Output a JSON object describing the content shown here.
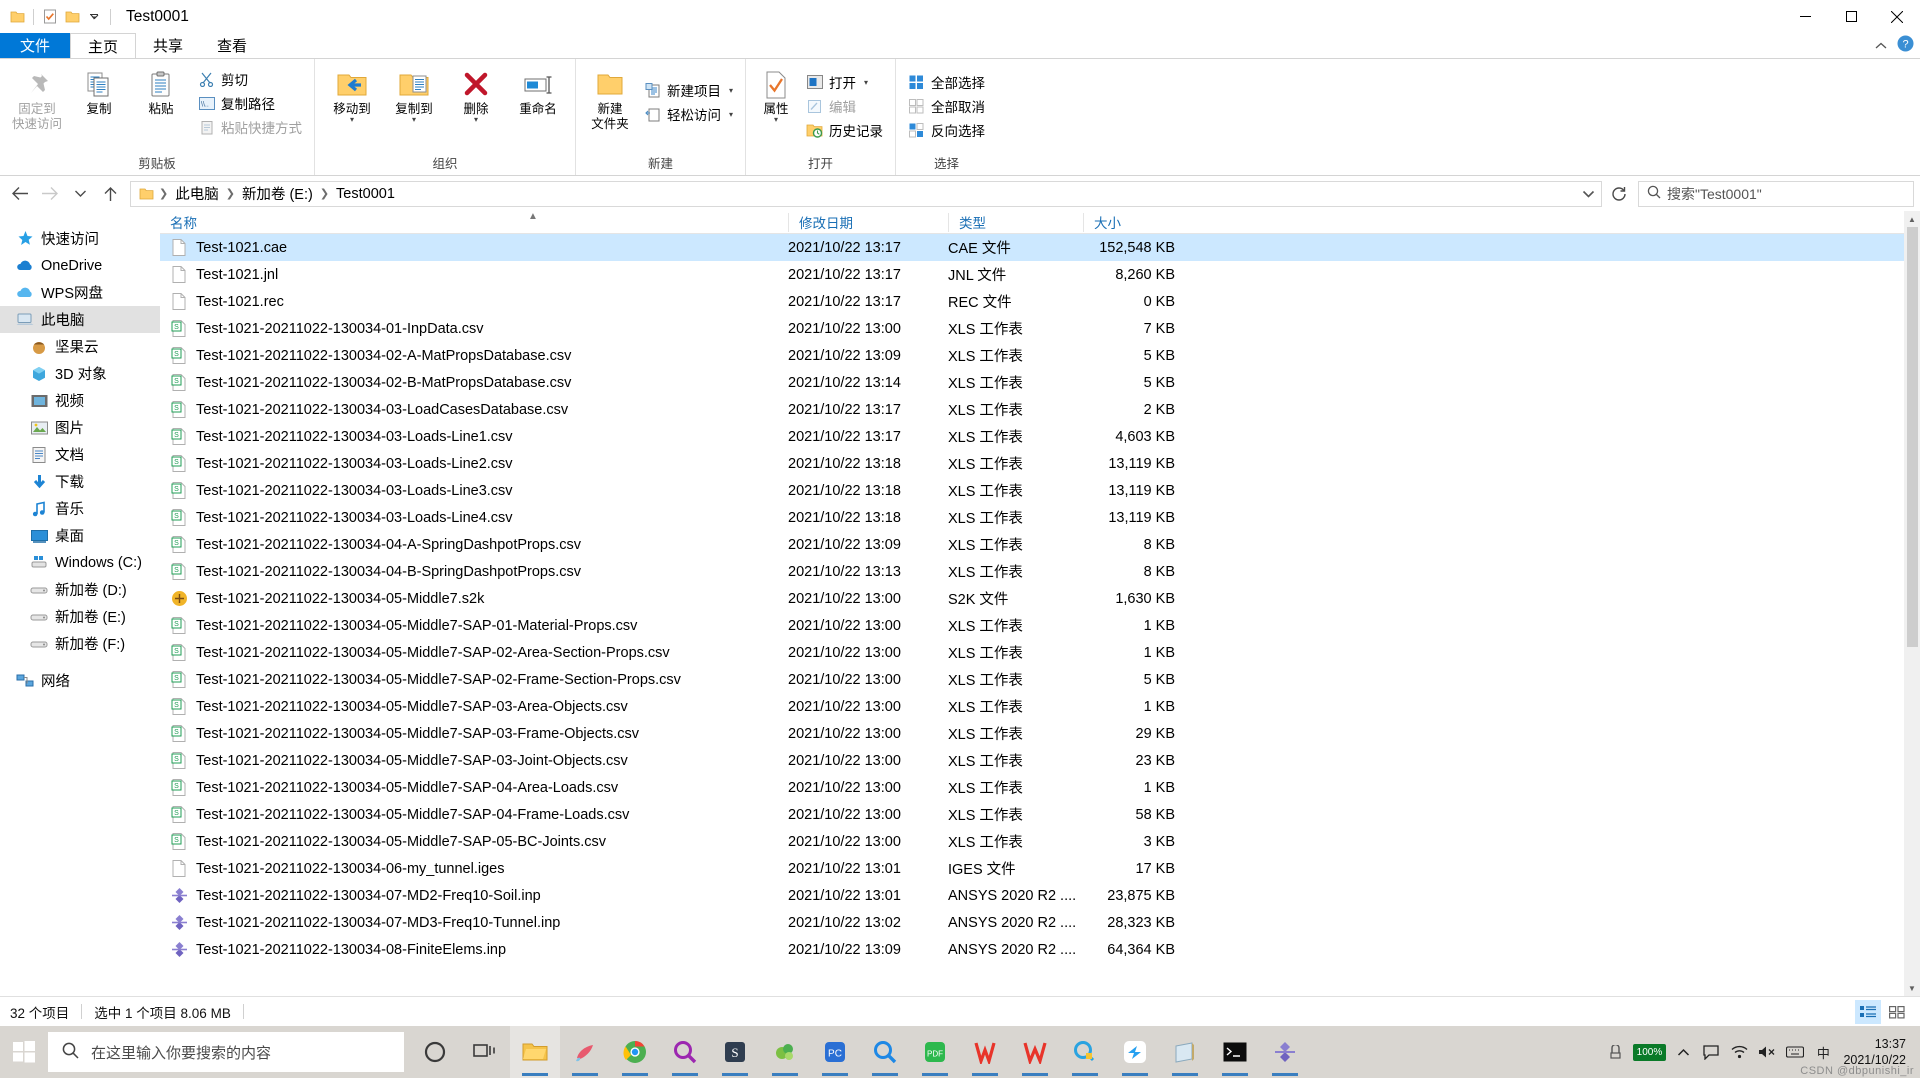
{
  "window": {
    "title": "Test0001",
    "qat": [
      "folder-icon",
      "properties-icon",
      "new-folder-icon",
      "customize-dropdown-icon"
    ],
    "buttons": {
      "minimize": "minimize-icon",
      "maximize": "maximize-icon",
      "close": "close-icon"
    }
  },
  "ribbon": {
    "tabs": [
      {
        "label": "文件",
        "kind": "file"
      },
      {
        "label": "主页",
        "kind": "active"
      },
      {
        "label": "共享",
        "kind": "normal"
      },
      {
        "label": "查看",
        "kind": "normal"
      }
    ],
    "groups": [
      {
        "label": "剪贴板",
        "big": [
          {
            "label": "固定到\n快速访问",
            "icon": "pin-icon",
            "disabled": true
          },
          {
            "label": "复制",
            "icon": "copy-icon",
            "disabled": false
          },
          {
            "label": "粘贴",
            "icon": "paste-icon",
            "disabled": false
          }
        ],
        "small": [
          {
            "label": "剪切",
            "icon": "scissors-icon",
            "disabled": false
          },
          {
            "label": "复制路径",
            "icon": "copy-path-icon",
            "disabled": false
          },
          {
            "label": "粘贴快捷方式",
            "icon": "paste-shortcut-icon",
            "disabled": true
          }
        ]
      },
      {
        "label": "组织",
        "big": [
          {
            "label": "移动到",
            "icon": "move-to-icon",
            "dropdown": true
          },
          {
            "label": "复制到",
            "icon": "copy-to-icon",
            "dropdown": true
          },
          {
            "label": "删除",
            "icon": "delete-icon",
            "dropdown": true
          },
          {
            "label": "重命名",
            "icon": "rename-icon",
            "dropdown": false
          }
        ],
        "small": []
      },
      {
        "label": "新建",
        "big": [
          {
            "label": "新建\n文件夹",
            "icon": "new-folder-icon",
            "dropdown": false
          }
        ],
        "small": [
          {
            "label": "新建项目",
            "icon": "new-item-icon",
            "dropdown": true
          },
          {
            "label": "轻松访问",
            "icon": "easy-access-icon",
            "dropdown": true
          }
        ]
      },
      {
        "label": "打开",
        "big": [
          {
            "label": "属性",
            "icon": "properties-icon",
            "dropdown": true
          }
        ],
        "small": [
          {
            "label": "打开",
            "icon": "open-icon",
            "dropdown": true
          },
          {
            "label": "编辑",
            "icon": "edit-icon",
            "disabled": true
          },
          {
            "label": "历史记录",
            "icon": "history-icon",
            "disabled": false
          }
        ]
      },
      {
        "label": "选择",
        "big": [],
        "small": [
          {
            "label": "全部选择",
            "icon": "select-all-icon"
          },
          {
            "label": "全部取消",
            "icon": "select-none-icon"
          },
          {
            "label": "反向选择",
            "icon": "invert-selection-icon"
          }
        ]
      }
    ]
  },
  "address": {
    "back": "back-arrow-icon",
    "forward": "forward-arrow-icon",
    "recent": "recent-locations-icon",
    "up": "up-arrow-icon",
    "crumbs": [
      "此电脑",
      "新加卷 (E:)",
      "Test0001"
    ],
    "refresh": "refresh-icon",
    "search_placeholder": "搜索\"Test0001\"",
    "search_value": ""
  },
  "sidebar": {
    "items": [
      {
        "label": "快速访问",
        "icon": "quick-access-star-icon",
        "level": 1,
        "selected": false
      },
      {
        "label": "OneDrive",
        "icon": "onedrive-cloud-icon",
        "level": 1,
        "selected": false
      },
      {
        "label": "WPS网盘",
        "icon": "wps-cloud-icon",
        "level": 1,
        "selected": false
      },
      {
        "label": "此电脑",
        "icon": "this-pc-icon",
        "level": 1,
        "selected": true
      },
      {
        "label": "坚果云",
        "icon": "nutstore-icon",
        "level": 2,
        "selected": false
      },
      {
        "label": "3D 对象",
        "icon": "3d-objects-icon",
        "level": 2,
        "selected": false
      },
      {
        "label": "视频",
        "icon": "videos-icon",
        "level": 2,
        "selected": false
      },
      {
        "label": "图片",
        "icon": "pictures-icon",
        "level": 2,
        "selected": false
      },
      {
        "label": "文档",
        "icon": "documents-icon",
        "level": 2,
        "selected": false
      },
      {
        "label": "下载",
        "icon": "downloads-icon",
        "level": 2,
        "selected": false
      },
      {
        "label": "音乐",
        "icon": "music-icon",
        "level": 2,
        "selected": false
      },
      {
        "label": "桌面",
        "icon": "desktop-icon",
        "level": 2,
        "selected": false
      },
      {
        "label": "Windows (C:)",
        "icon": "windows-drive-icon",
        "level": 2,
        "selected": false
      },
      {
        "label": "新加卷 (D:)",
        "icon": "drive-icon",
        "level": 2,
        "selected": false
      },
      {
        "label": "新加卷 (E:)",
        "icon": "drive-icon",
        "level": 2,
        "selected": false
      },
      {
        "label": "新加卷 (F:)",
        "icon": "drive-icon",
        "level": 2,
        "selected": false
      },
      {
        "label": "网络",
        "icon": "network-icon",
        "level": 1,
        "selected": false
      }
    ]
  },
  "filelist": {
    "columns": [
      "名称",
      "修改日期",
      "类型",
      "大小"
    ],
    "sort_column": "名称",
    "sort_dir": "asc",
    "rows": [
      {
        "name": "Test-1021.cae",
        "date": "2021/10/22 13:17",
        "type": "CAE 文件",
        "size": "152,548 KB",
        "icon": "generic-file-icon",
        "selected": true
      },
      {
        "name": "Test-1021.jnl",
        "date": "2021/10/22 13:17",
        "type": "JNL 文件",
        "size": "8,260 KB",
        "icon": "generic-file-icon",
        "selected": false
      },
      {
        "name": "Test-1021.rec",
        "date": "2021/10/22 13:17",
        "type": "REC 文件",
        "size": "0 KB",
        "icon": "generic-file-icon",
        "selected": false
      },
      {
        "name": "Test-1021-20211022-130034-01-InpData.csv",
        "date": "2021/10/22 13:00",
        "type": "XLS 工作表",
        "size": "7 KB",
        "icon": "csv-file-icon",
        "selected": false
      },
      {
        "name": "Test-1021-20211022-130034-02-A-MatPropsDatabase.csv",
        "date": "2021/10/22 13:09",
        "type": "XLS 工作表",
        "size": "5 KB",
        "icon": "csv-file-icon",
        "selected": false
      },
      {
        "name": "Test-1021-20211022-130034-02-B-MatPropsDatabase.csv",
        "date": "2021/10/22 13:14",
        "type": "XLS 工作表",
        "size": "5 KB",
        "icon": "csv-file-icon",
        "selected": false
      },
      {
        "name": "Test-1021-20211022-130034-03-LoadCasesDatabase.csv",
        "date": "2021/10/22 13:17",
        "type": "XLS 工作表",
        "size": "2 KB",
        "icon": "csv-file-icon",
        "selected": false
      },
      {
        "name": "Test-1021-20211022-130034-03-Loads-Line1.csv",
        "date": "2021/10/22 13:17",
        "type": "XLS 工作表",
        "size": "4,603 KB",
        "icon": "csv-file-icon",
        "selected": false
      },
      {
        "name": "Test-1021-20211022-130034-03-Loads-Line2.csv",
        "date": "2021/10/22 13:18",
        "type": "XLS 工作表",
        "size": "13,119 KB",
        "icon": "csv-file-icon",
        "selected": false
      },
      {
        "name": "Test-1021-20211022-130034-03-Loads-Line3.csv",
        "date": "2021/10/22 13:18",
        "type": "XLS 工作表",
        "size": "13,119 KB",
        "icon": "csv-file-icon",
        "selected": false
      },
      {
        "name": "Test-1021-20211022-130034-03-Loads-Line4.csv",
        "date": "2021/10/22 13:18",
        "type": "XLS 工作表",
        "size": "13,119 KB",
        "icon": "csv-file-icon",
        "selected": false
      },
      {
        "name": "Test-1021-20211022-130034-04-A-SpringDashpotProps.csv",
        "date": "2021/10/22 13:09",
        "type": "XLS 工作表",
        "size": "8 KB",
        "icon": "csv-file-icon",
        "selected": false
      },
      {
        "name": "Test-1021-20211022-130034-04-B-SpringDashpotProps.csv",
        "date": "2021/10/22 13:13",
        "type": "XLS 工作表",
        "size": "8 KB",
        "icon": "csv-file-icon",
        "selected": false
      },
      {
        "name": "Test-1021-20211022-130034-05-Middle7.s2k",
        "date": "2021/10/22 13:00",
        "type": "S2K 文件",
        "size": "1,630 KB",
        "icon": "s2k-file-icon",
        "selected": false
      },
      {
        "name": "Test-1021-20211022-130034-05-Middle7-SAP-01-Material-Props.csv",
        "date": "2021/10/22 13:00",
        "type": "XLS 工作表",
        "size": "1 KB",
        "icon": "csv-file-icon",
        "selected": false
      },
      {
        "name": "Test-1021-20211022-130034-05-Middle7-SAP-02-Area-Section-Props.csv",
        "date": "2021/10/22 13:00",
        "type": "XLS 工作表",
        "size": "1 KB",
        "icon": "csv-file-icon",
        "selected": false
      },
      {
        "name": "Test-1021-20211022-130034-05-Middle7-SAP-02-Frame-Section-Props.csv",
        "date": "2021/10/22 13:00",
        "type": "XLS 工作表",
        "size": "5 KB",
        "icon": "csv-file-icon",
        "selected": false
      },
      {
        "name": "Test-1021-20211022-130034-05-Middle7-SAP-03-Area-Objects.csv",
        "date": "2021/10/22 13:00",
        "type": "XLS 工作表",
        "size": "1 KB",
        "icon": "csv-file-icon",
        "selected": false
      },
      {
        "name": "Test-1021-20211022-130034-05-Middle7-SAP-03-Frame-Objects.csv",
        "date": "2021/10/22 13:00",
        "type": "XLS 工作表",
        "size": "29 KB",
        "icon": "csv-file-icon",
        "selected": false
      },
      {
        "name": "Test-1021-20211022-130034-05-Middle7-SAP-03-Joint-Objects.csv",
        "date": "2021/10/22 13:00",
        "type": "XLS 工作表",
        "size": "23 KB",
        "icon": "csv-file-icon",
        "selected": false
      },
      {
        "name": "Test-1021-20211022-130034-05-Middle7-SAP-04-Area-Loads.csv",
        "date": "2021/10/22 13:00",
        "type": "XLS 工作表",
        "size": "1 KB",
        "icon": "csv-file-icon",
        "selected": false
      },
      {
        "name": "Test-1021-20211022-130034-05-Middle7-SAP-04-Frame-Loads.csv",
        "date": "2021/10/22 13:00",
        "type": "XLS 工作表",
        "size": "58 KB",
        "icon": "csv-file-icon",
        "selected": false
      },
      {
        "name": "Test-1021-20211022-130034-05-Middle7-SAP-05-BC-Joints.csv",
        "date": "2021/10/22 13:00",
        "type": "XLS 工作表",
        "size": "3 KB",
        "icon": "csv-file-icon",
        "selected": false
      },
      {
        "name": "Test-1021-20211022-130034-06-my_tunnel.iges",
        "date": "2021/10/22 13:01",
        "type": "IGES 文件",
        "size": "17 KB",
        "icon": "generic-file-icon",
        "selected": false
      },
      {
        "name": "Test-1021-20211022-130034-07-MD2-Freq10-Soil.inp",
        "date": "2021/10/22 13:01",
        "type": "ANSYS 2020 R2 ....",
        "size": "23,875 KB",
        "icon": "ansys-file-icon",
        "selected": false
      },
      {
        "name": "Test-1021-20211022-130034-07-MD3-Freq10-Tunnel.inp",
        "date": "2021/10/22 13:02",
        "type": "ANSYS 2020 R2 ....",
        "size": "28,323 KB",
        "icon": "ansys-file-icon",
        "selected": false
      },
      {
        "name": "Test-1021-20211022-130034-08-FiniteElems.inp",
        "date": "2021/10/22 13:09",
        "type": "ANSYS 2020 R2 ....",
        "size": "64,364 KB",
        "icon": "ansys-file-icon",
        "selected": false
      }
    ]
  },
  "status": {
    "item_count": "32 个项目",
    "selection": "选中 1 个项目  8.06 MB",
    "view_details": "details-view-icon",
    "view_large": "large-icons-view-icon"
  },
  "taskbar": {
    "start": "windows-start-icon",
    "search_placeholder": "在这里输入你要搜索的内容",
    "cortana": "cortana-circle-icon",
    "taskview": "task-view-icon",
    "apps": [
      {
        "name": "file-explorer-icon",
        "running": true,
        "active": true
      },
      {
        "name": "paint-3d-icon",
        "running": true
      },
      {
        "name": "chrome-icon",
        "running": true
      },
      {
        "name": "everything-search-icon",
        "running": true
      },
      {
        "name": "sap2000-icon",
        "running": true
      },
      {
        "name": "abaqus-icon",
        "running": true
      },
      {
        "name": "pc-manager-icon",
        "running": true
      },
      {
        "name": "magnifier-search-icon",
        "running": true
      },
      {
        "name": "pdf-reader-icon",
        "running": true
      },
      {
        "name": "wps-word-a-icon",
        "running": true
      },
      {
        "name": "wps-writer-icon",
        "running": true
      },
      {
        "name": "qq-icon",
        "running": true
      },
      {
        "name": "teambition-icon",
        "running": true
      },
      {
        "name": "notepad-icon",
        "running": true
      },
      {
        "name": "command-prompt-icon",
        "running": true
      },
      {
        "name": "ansys-icon",
        "running": true
      }
    ],
    "tray": {
      "battery_percent": "100%",
      "chevron": "show-hidden-icons-icon",
      "action_center": "action-center-icon",
      "network": "network-icon",
      "volume": "volume-muted-icon",
      "keyboard": "keyboard-icon",
      "ime": "ime-chinese-icon",
      "time": "13:37",
      "date": "2021/10/22"
    }
  },
  "watermark": "CSDN @dbpunishi_ir"
}
